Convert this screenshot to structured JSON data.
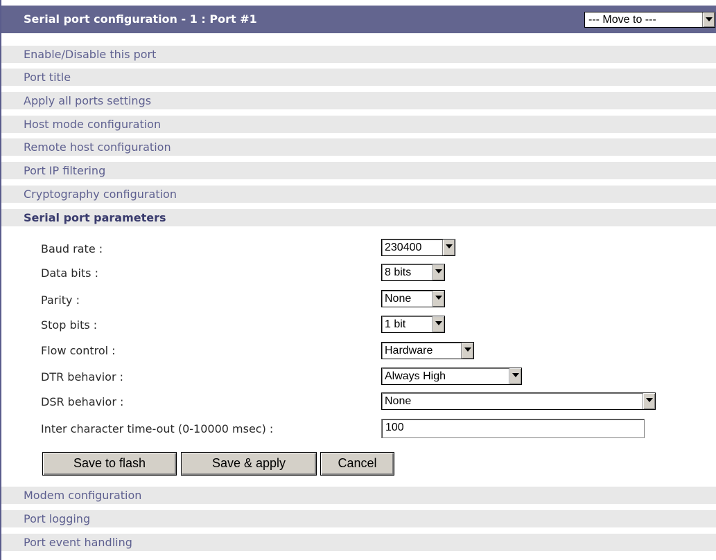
{
  "header": {
    "title": "Serial port configuration - 1 : Port #1",
    "move_to": "--- Move to ---"
  },
  "sections_top": [
    "Enable/Disable this port",
    "Port title",
    "Apply all ports settings",
    "Host mode configuration",
    "Remote host configuration",
    "Port IP filtering",
    "Cryptography configuration",
    "Serial port parameters"
  ],
  "sections_bottom": [
    "Modem configuration",
    "Port logging",
    "Port event handling"
  ],
  "form": {
    "baud_rate": {
      "label": "Baud rate :",
      "value": "230400"
    },
    "data_bits": {
      "label": "Data bits :",
      "value": "8 bits"
    },
    "parity": {
      "label": "Parity :",
      "value": "None"
    },
    "stop_bits": {
      "label": "Stop bits :",
      "value": "1 bit"
    },
    "flow_control": {
      "label": "Flow control :",
      "value": "Hardware"
    },
    "dtr": {
      "label": "DTR behavior :",
      "value": "Always High"
    },
    "dsr": {
      "label": "DSR behavior :",
      "value": "None"
    },
    "inter_char": {
      "label": "Inter character time-out (0-10000 msec) :",
      "value": "100"
    }
  },
  "buttons": {
    "save_flash": "Save to flash",
    "save_apply": "Save & apply",
    "cancel": "Cancel"
  },
  "colors": {
    "header_bg": "#63658f",
    "section_bg": "#e8e8e8",
    "section_text": "#5e6090"
  }
}
